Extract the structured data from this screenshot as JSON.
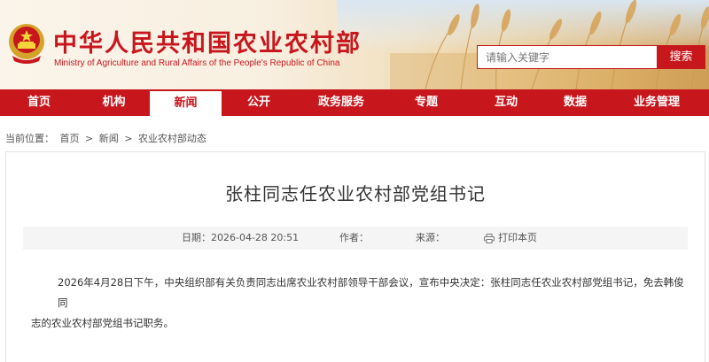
{
  "header": {
    "title_zh": "中华人民共和国农业农村部",
    "title_en": "Ministry of Agriculture and Rural Affairs of the People's Republic of China",
    "search": {
      "placeholder": "请输入关键字",
      "button_label": "搜索"
    }
  },
  "nav": {
    "items": [
      {
        "label": "首页"
      },
      {
        "label": "机构"
      },
      {
        "label": "新闻"
      },
      {
        "label": "公开"
      },
      {
        "label": "政务服务"
      },
      {
        "label": "专题"
      },
      {
        "label": "互动"
      },
      {
        "label": "数据"
      },
      {
        "label": "业务管理"
      }
    ],
    "active_index": 2
  },
  "breadcrumb": {
    "prefix": "当前位置：",
    "items": [
      "首页",
      "新闻",
      "农业农村部动态"
    ],
    "separator": ">"
  },
  "article": {
    "title": "张柱同志任农业农村部党组书记",
    "meta": {
      "date_label": "日期：",
      "date_value": "2026-04-28 20:51",
      "author_label": "作者：",
      "source_label": "来源：",
      "print_label": "打印本页"
    },
    "body_line1": "2026年4月28日下午，中央组织部有关负责同志出席农业农村部领导干部会议，宣布中央决定：张柱同志任农业农村部党组书记，免去韩俊同",
    "body_line2": "志的农业农村部党组书记职务。"
  },
  "colors": {
    "brand_red": "#c8161d",
    "meta_bg": "#f5f5f5"
  }
}
